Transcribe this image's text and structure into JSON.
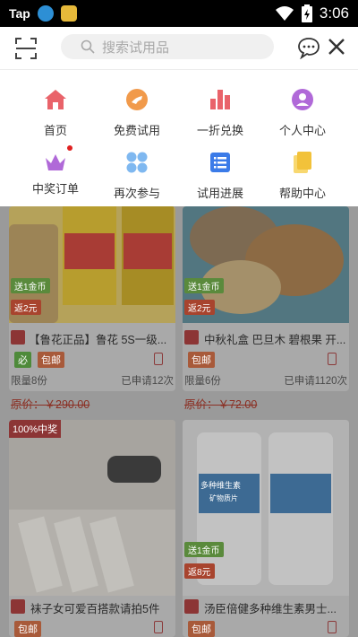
{
  "statusbar": {
    "app_text": "Tap",
    "time": "3:06",
    "icons": [
      "tap-app-icon",
      "circle-app-icon",
      "bag-app-icon",
      "wifi-icon",
      "battery-icon"
    ]
  },
  "header": {
    "search_placeholder": "搜索试用品",
    "icons": [
      "scan-icon",
      "search-icon",
      "message-icon",
      "close-icon"
    ]
  },
  "menu": {
    "items": [
      {
        "label": "首页",
        "icon": "home-icon",
        "color": "#e9636a"
      },
      {
        "label": "免费试用",
        "icon": "hand-icon",
        "color": "#f19a4b"
      },
      {
        "label": "一折兑换",
        "icon": "bar-chart-icon",
        "color": "#e9636a"
      },
      {
        "label": "个人中心",
        "icon": "person-icon",
        "color": "#b069d8"
      },
      {
        "label": "中奖订单",
        "icon": "crown-icon",
        "color": "#b069d8",
        "dot": true
      },
      {
        "label": "再次参与",
        "icon": "dots-icon",
        "color": "#7fb8f0"
      },
      {
        "label": "试用进展",
        "icon": "list-icon",
        "color": "#3b7be8"
      },
      {
        "label": "帮助中心",
        "icon": "note-icon",
        "color": "#f2c23a"
      }
    ]
  },
  "products": [
    {
      "title": "【鲁花正品】鲁花 5S一级...",
      "tag1": "送1金币",
      "tag2": "返2元",
      "bi": "必",
      "baoyou": "包邮",
      "limit": "限量8份",
      "applied": "已申请12次",
      "price": "原价：￥290.00"
    },
    {
      "title": "中秋礼盒 巴旦木 碧根果 开...",
      "tag1": "送1金币",
      "tag2": "返2元",
      "baoyou": "包邮",
      "limit": "限量6份",
      "applied": "已申请1120次",
      "price": "原价：￥72.00"
    },
    {
      "title": "袜子女可爱百搭款请拍5件",
      "badge": "100%中奖",
      "baoyou": "包邮"
    },
    {
      "title": "汤臣倍健多种维生素男士...",
      "tag1": "送1金币",
      "tag2": "返8元",
      "baoyou": "包邮",
      "img_text": "多种维生素",
      "img_sub": "矿物质片"
    }
  ]
}
